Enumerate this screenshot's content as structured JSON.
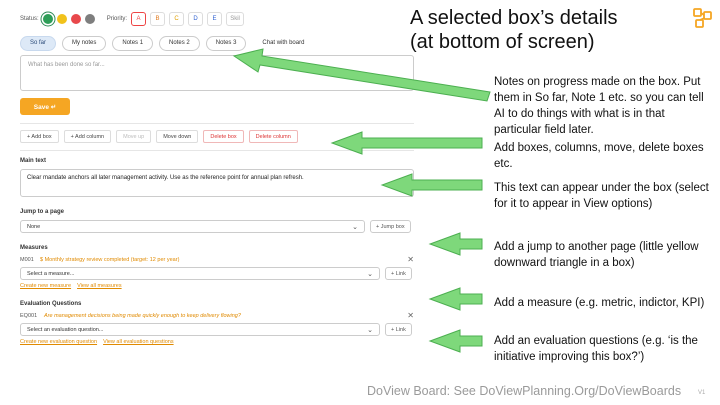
{
  "panel": {
    "status_label": "Status:",
    "priority_label": "Priority:",
    "status_colors": [
      "#2e9e58",
      "#f1c21b",
      "#e8484b",
      "#7e7e7e"
    ],
    "priorities": [
      "A",
      "B",
      "C",
      "D",
      "E"
    ],
    "priority_colors": [
      "#e44",
      "#e07a1f",
      "#e0a000",
      "#2d5fd0",
      "#2d5fd0"
    ],
    "priority_extra": "Skil",
    "tabs": [
      "So far",
      "My notes",
      "Notes 1",
      "Notes 2",
      "Notes 3",
      "Chat with board"
    ],
    "notes_placeholder": "What has been done so far...",
    "save_label": "Save ↵",
    "actions": [
      "+ Add box",
      "+ Add column",
      "Move up",
      "Move down",
      "Delete box",
      "Delete column"
    ],
    "main_text_label": "Main text",
    "main_text_value": "Clear mandate anchors all later management activity. Use as the reference point for annual plan refresh.",
    "jump_label": "Jump to a page",
    "jump_value": "None",
    "jump_button": "+ Jump box",
    "measures_label": "Measures",
    "measure_code": "M001",
    "measure_text": "$ Monthly strategy review completed (target: 12 per year)",
    "measure_select": "Select a measure...",
    "link_button": "+ Link",
    "measure_links": [
      "Create new measure",
      "View all measures"
    ],
    "eval_label": "Evaluation Questions",
    "eval_code": "EQ001",
    "eval_text": "Are management decisions being made quickly enough to keep delivery flowing?",
    "eval_select": "Select an evaluation question...",
    "eval_links": [
      "Create new evaluation question",
      "View all evaluation questions"
    ]
  },
  "annotations": {
    "title_line1": "A selected box’s details",
    "title_line2": "(at bottom of screen)",
    "note1": "Notes on progress made on the box. Put them in So far, Note 1 etc. so you can tell AI to do things with what is in that particular field later.",
    "note2": "Add boxes, columns, move, delete boxes etc.",
    "note3": "This text can appear under the box (select for it to appear in View options)",
    "note4": "Add a jump to another page (little yellow downward triangle in a box)",
    "note5": "Add a measure (e.g. metric, indictor, KPI)",
    "note6": "Add an evaluation questions (e.g. ‘is the initiative improving this box?’)"
  },
  "footer": "DoView Board: See DoViewPlanning.Org/DoViewBoards",
  "version": "V1",
  "colors": {
    "accent": "#f5a623",
    "arrow": "#7ed87b",
    "arrow_stroke": "#4caf50",
    "logo": "#f5a623"
  },
  "icons": [
    "dove-logo-icon",
    "chevron-down-icon",
    "close-icon"
  ]
}
